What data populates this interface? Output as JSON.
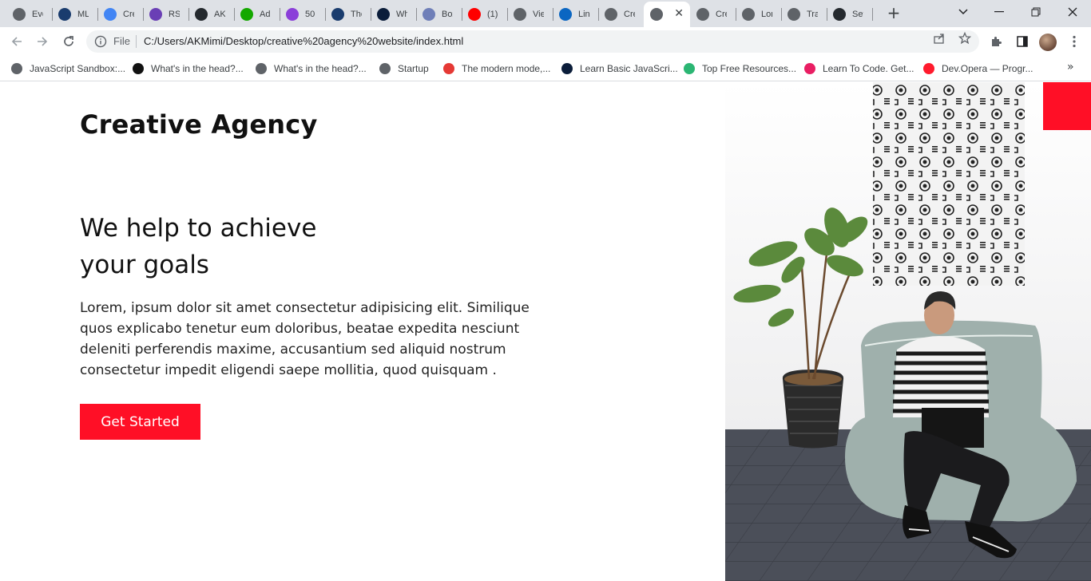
{
  "browser": {
    "tabs": [
      {
        "title": "Eve",
        "icon": "globe-grid-icon",
        "color": "#5f6368"
      },
      {
        "title": "ML",
        "icon": "shield-icon",
        "color": "#1a3c6e"
      },
      {
        "title": "Cre",
        "icon": "google-g-icon",
        "color": "#4285f4"
      },
      {
        "title": "RS\\",
        "icon": "list-box-icon",
        "color": "#6a3fb5"
      },
      {
        "title": "AKI",
        "icon": "github-icon",
        "color": "#24292e"
      },
      {
        "title": "Ad",
        "icon": "upwork-icon",
        "color": "#14a800"
      },
      {
        "title": "50",
        "icon": "coin-icon",
        "color": "#8b3fd9"
      },
      {
        "title": "The",
        "icon": "shield-icon",
        "color": "#1a3c6e"
      },
      {
        "title": "Wh",
        "icon": "triangle-logo-icon",
        "color": "#0b1d3a"
      },
      {
        "title": "Box",
        "icon": "box-icon",
        "color": "#6f7fb8"
      },
      {
        "title": "(1)",
        "icon": "youtube-icon",
        "color": "#ff0000"
      },
      {
        "title": "Vie",
        "icon": "broadcast-icon",
        "color": "#5f6368"
      },
      {
        "title": "Lin",
        "icon": "linkedin-icon",
        "color": "#0a66c2"
      },
      {
        "title": "Cre",
        "icon": "globe-icon",
        "color": "#5f6368"
      },
      {
        "title": "",
        "icon": "globe-icon",
        "color": "#5f6368",
        "active": true
      },
      {
        "title": "Cre",
        "icon": "globe-icon",
        "color": "#5f6368"
      },
      {
        "title": "Lor",
        "icon": "globe-icon",
        "color": "#5f6368"
      },
      {
        "title": "Tra",
        "icon": "globe-icon",
        "color": "#5f6368"
      },
      {
        "title": "Set",
        "icon": "github-icon",
        "color": "#24292e"
      }
    ],
    "omnibox": {
      "scheme_label": "File",
      "url": "C:/Users/AKMimi/Desktop/creative%20agency%20website/index.html"
    },
    "bookmarks": [
      {
        "label": "JavaScript Sandbox:...",
        "icon": "globe-icon",
        "color": "#5f6368"
      },
      {
        "label": "What's in the head?...",
        "icon": "m-logo-icon",
        "color": "#111111"
      },
      {
        "label": "What's in the head?...",
        "icon": "globe-icon",
        "color": "#5f6368"
      },
      {
        "label": "Startup",
        "icon": "globe-icon",
        "color": "#5f6368"
      },
      {
        "label": "The modern mode,...",
        "icon": "tower-icon",
        "color": "#e53935"
      },
      {
        "label": "Learn Basic JavaScri...",
        "icon": "triangle-logo-icon",
        "color": "#0b1d3a"
      },
      {
        "label": "Top Free Resources...",
        "icon": "layers-icon",
        "color": "#2bb673"
      },
      {
        "label": "Learn To Code. Get...",
        "icon": "layers-icon",
        "color": "#e91e63"
      },
      {
        "label": "Dev.Opera — Progr...",
        "icon": "opera-icon",
        "color": "#ff1b2d"
      }
    ]
  },
  "site": {
    "brand": "Creative Agency",
    "headline_line1": "We help to achieve",
    "headline_line2": "your goals",
    "paragraph": "Lorem, ipsum dolor sit amet consectetur adipisicing elit. Similique quos explicabo tenetur eum doloribus, beatae expedita nesciunt deleniti perferendis maxime, accusantium sed aliquid nostrum consectetur impedit eligendi saepe mollitia, quod quisquam .",
    "cta_label": "Get Started",
    "accent_color": "#ff0f26"
  }
}
